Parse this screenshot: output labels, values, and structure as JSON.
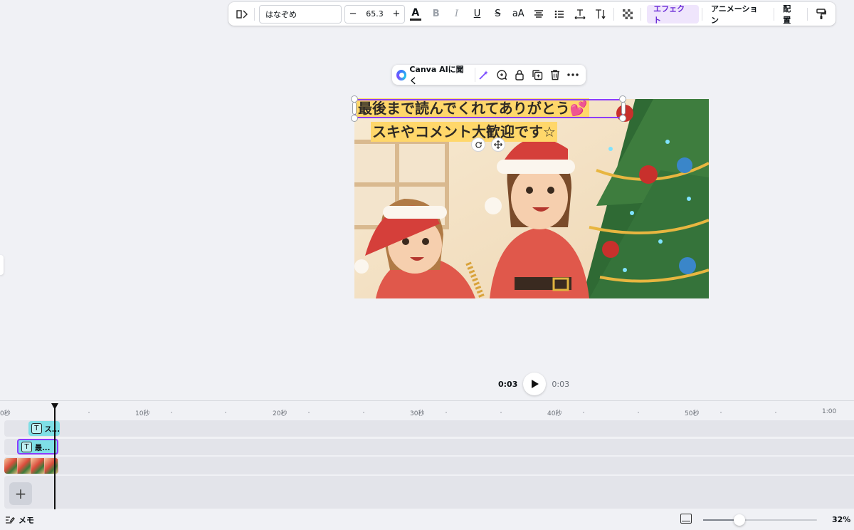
{
  "toolbar": {
    "font_name": "はなぞめ",
    "font_size": "65.3",
    "minus": "−",
    "plus": "+",
    "case_label": "aA",
    "effects_label": "エフェクト",
    "animation_label": "アニメーション",
    "position_label": "配置",
    "icons": [
      "flip-icon",
      "text-color-icon",
      "bold-icon",
      "italic-icon",
      "underline-icon",
      "strikethrough-icon",
      "case-icon",
      "align-icon",
      "list-icon",
      "letter-spacing-icon",
      "text-direction-icon",
      "transparency-icon",
      "paint-format-icon"
    ]
  },
  "context_menu": {
    "ai_label": "Canva AIに聞く",
    "icons": [
      "magic-edit-icon",
      "comment-icon",
      "lock-icon",
      "duplicate-icon",
      "delete-icon",
      "more-icon"
    ]
  },
  "canvas": {
    "caption_line1": "最後まで読んでくれてありがとう💕",
    "caption_line2": "スキやコメント大歓迎です☆"
  },
  "playback": {
    "current_time": "0:03",
    "total_time": "0:03"
  },
  "timeline": {
    "ruler_labels": [
      "0秒",
      "10秒",
      "20秒",
      "30秒",
      "40秒",
      "50秒",
      "1:00"
    ],
    "clips": [
      {
        "icon": "T",
        "label": "ス..."
      },
      {
        "icon": "T",
        "label": "最..."
      }
    ],
    "add_label": "+"
  },
  "bottombar": {
    "memo_label": "メモ",
    "zoom_percent": "32%",
    "zoom_level": 0.32
  },
  "colors": {
    "accent": "#8b3dff",
    "caption_highlight": "#ffd76a",
    "clip": "#7fdfe6"
  }
}
